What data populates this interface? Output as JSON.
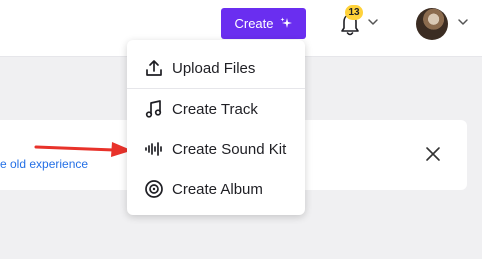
{
  "header": {
    "create_label": "Create",
    "notification_count": "13",
    "icons": [
      "sparkle-icon",
      "bell-icon",
      "chevron-down-icon",
      "avatar"
    ]
  },
  "banner": {
    "link_text": "e old experience",
    "close_icon": "close-icon"
  },
  "create_menu": {
    "items": [
      {
        "label": "Upload Files",
        "icon": "upload-icon"
      },
      {
        "label": "Create Track",
        "icon": "music-note-icon"
      },
      {
        "label": "Create Sound Kit",
        "icon": "waveform-icon"
      },
      {
        "label": "Create Album",
        "icon": "album-icon"
      }
    ]
  },
  "colors": {
    "accent": "#6a2ef0",
    "badge": "#ffd23a",
    "link": "#2470e6",
    "annotation_arrow": "#e8322a"
  }
}
